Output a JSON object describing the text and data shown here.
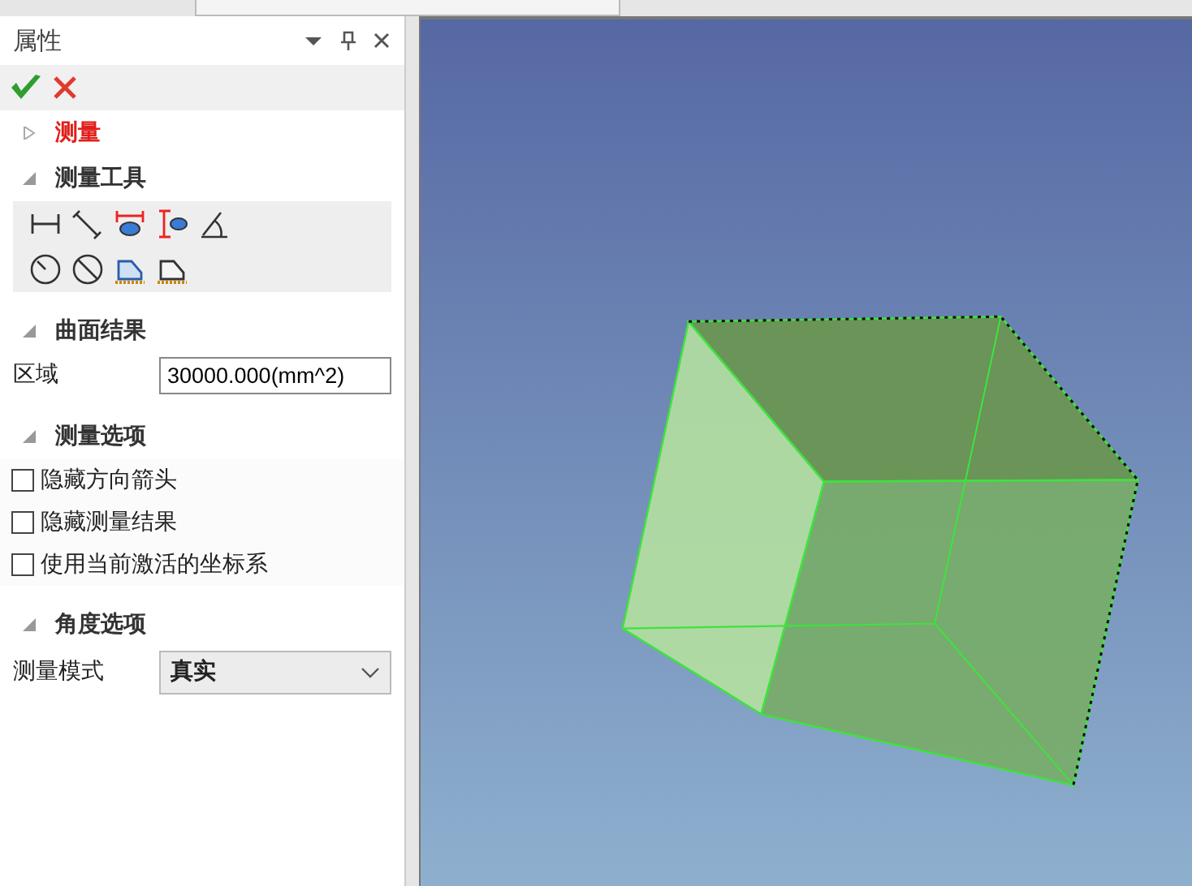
{
  "panel": {
    "title": "属性"
  },
  "sections": [
    {
      "title": "测量",
      "expanded": false,
      "active": true
    },
    {
      "title": "测量工具",
      "expanded": true,
      "active": false,
      "items": [
        {
          "kind": "toolbar"
        }
      ]
    },
    {
      "title": "曲面结果",
      "expanded": true,
      "active": false,
      "items": [
        {
          "kind": "field",
          "label": "区域",
          "value": "30000.000(mm^2)"
        }
      ]
    },
    {
      "title": "测量选项",
      "expanded": true,
      "active": false,
      "items": [
        {
          "kind": "checkbox",
          "label": "隐藏方向箭头",
          "checked": false
        },
        {
          "kind": "checkbox",
          "label": "隐藏测量结果",
          "checked": false
        },
        {
          "kind": "checkbox",
          "label": "使用当前激活的坐标系",
          "checked": false
        }
      ]
    },
    {
      "title": "角度选项",
      "expanded": true,
      "active": false,
      "items": [
        {
          "kind": "select",
          "label": "测量模式",
          "value": "真实"
        }
      ]
    }
  ]
}
